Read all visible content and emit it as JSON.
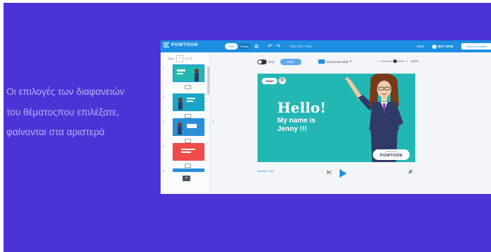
{
  "caption": {
    "lines": [
      "Οι επιλογές των διαφανειών",
      "του θέματοςπου επιλέξατε,",
      "φαίνονται στα αριστερά"
    ]
  },
  "colors": {
    "background": "#4a34d6",
    "caption_text": "#b9b2f4",
    "topbar": "#1d8fe0",
    "stage": "#23b7b3"
  },
  "app": {
    "logo": "POWTOON",
    "edit_label": "Edit",
    "other_tab": "Create",
    "title": "Time For! / Hero",
    "save_label": "Save",
    "buy_label": "BUY NOW",
    "export_label": "Export & publish",
    "slides": {
      "label": "Slide",
      "current": "1",
      "total_label": "of 10",
      "thumbs": [
        "1",
        "2",
        "3",
        "4",
        "5"
      ]
    },
    "toolbar": {
      "grid_label": "Grid",
      "add_label": "ADD",
      "layout_label": "Horizontal Slide",
      "zoom_label": "100%"
    },
    "stage": {
      "swap_label": "SWAP",
      "hello": "Hello!",
      "name_line1": "My name is",
      "name_line2": "Jenny !!!",
      "badge_small": "created using",
      "badge_main": "POWTOON"
    },
    "bottom": {
      "breadcrumb": "Middle / Hold",
      "timer": "[▸]"
    }
  }
}
